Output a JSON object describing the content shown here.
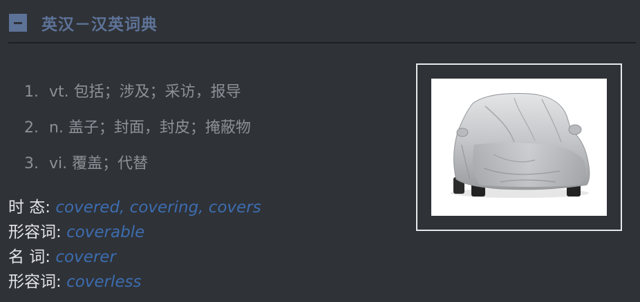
{
  "section": {
    "title": "英汉－汉英词典",
    "collapse_icon": "minus-icon"
  },
  "definitions": [
    {
      "num": "1.",
      "text": "vt. 包括；涉及；采访，报导"
    },
    {
      "num": "2.",
      "text": "n. 盖子；封面，封皮；掩蔽物"
    },
    {
      "num": "3.",
      "text": "vi. 覆盖；代替"
    }
  ],
  "word_forms": [
    {
      "label": "时 态: ",
      "value": "covered, covering, covers"
    },
    {
      "label": "形容词: ",
      "value": "coverable"
    },
    {
      "label": "名 词: ",
      "value": "coverer"
    },
    {
      "label": "形容词: ",
      "value": "coverless"
    }
  ],
  "image": {
    "subject": "car-cover-photo"
  },
  "colors": {
    "background": "#2f3237",
    "accent": "#5e7398",
    "link": "#3d6db0",
    "definition_text": "#8d9096",
    "label_text": "#e3e4e6"
  }
}
